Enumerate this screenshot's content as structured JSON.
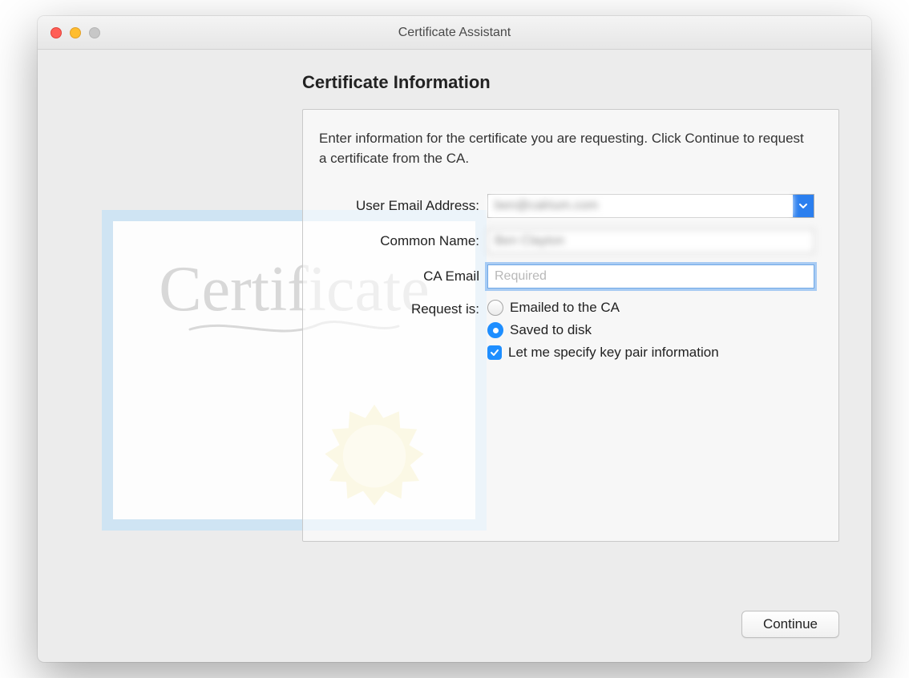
{
  "window": {
    "title": "Certificate Assistant"
  },
  "section": {
    "title": "Certificate Information",
    "instructions": "Enter information for the certificate you are requesting. Click Continue to request a certificate from the CA."
  },
  "form": {
    "email_label": "User Email Address:",
    "email_value": "ben@calrium.com",
    "common_name_label": "Common Name:",
    "common_name_value": "Ben Clayton",
    "ca_email_label": "CA Email",
    "ca_email_placeholder": "Required",
    "request_label": "Request is:",
    "option_email_ca": "Emailed to the CA",
    "option_save_disk": "Saved to disk",
    "option_keypair": "Let me specify key pair information",
    "selected_request": "saved",
    "keypair_checked": true
  },
  "footer": {
    "continue_label": "Continue"
  },
  "decor": {
    "cert_word": "Certificate"
  }
}
